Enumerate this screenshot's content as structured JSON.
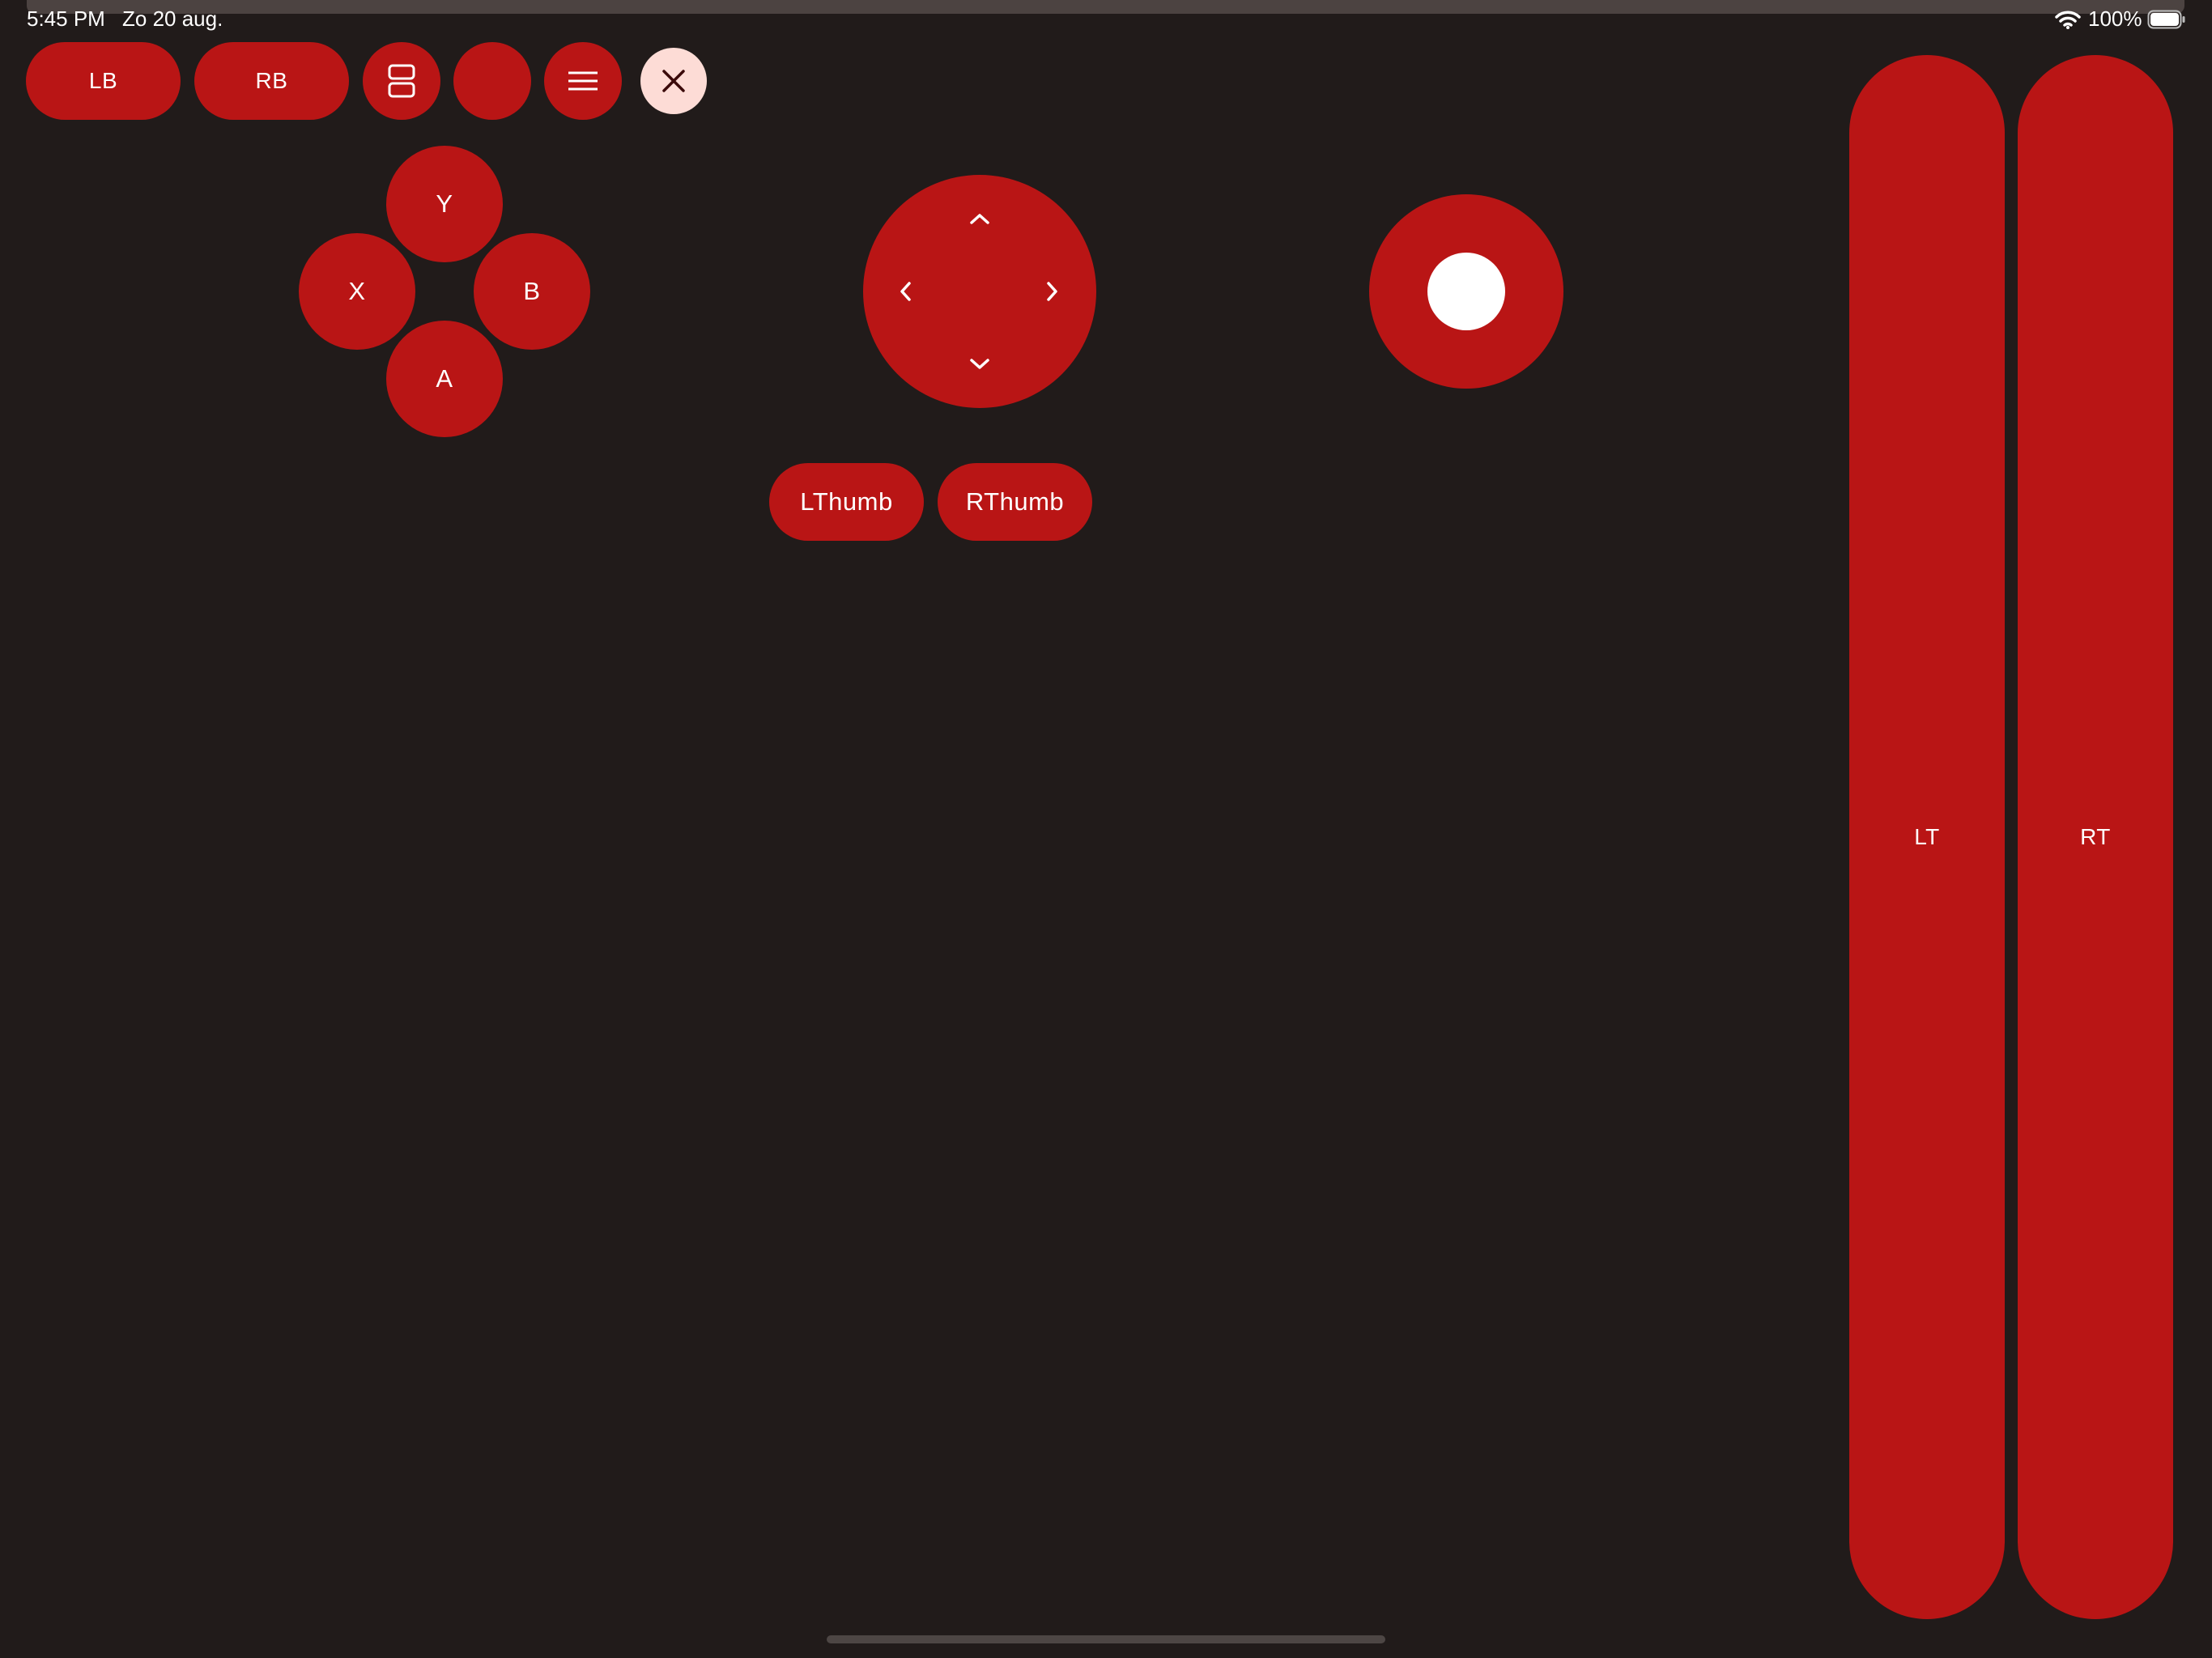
{
  "status_bar": {
    "time": "5:45 PM",
    "date": "Zo 20 aug.",
    "battery_percent": "100%",
    "icons": [
      "wifi-icon",
      "battery-icon"
    ]
  },
  "toolbar": {
    "lb_label": "LB",
    "rb_label": "RB",
    "icons": [
      "view-toggle-icon",
      "menu-icon",
      "close-icon"
    ]
  },
  "face_buttons": {
    "y": "Y",
    "x": "X",
    "b": "B",
    "a": "A"
  },
  "dpad": {
    "icons": [
      "chevron-up-icon",
      "chevron-left-icon",
      "chevron-right-icon",
      "chevron-down-icon"
    ]
  },
  "thumbs": {
    "left": "LThumb",
    "right": "RThumb"
  },
  "triggers": {
    "lt": "LT",
    "rt": "RT"
  },
  "colors": {
    "background": "#211b1a",
    "accent": "#b91515",
    "close_button": "#fddcd6"
  }
}
